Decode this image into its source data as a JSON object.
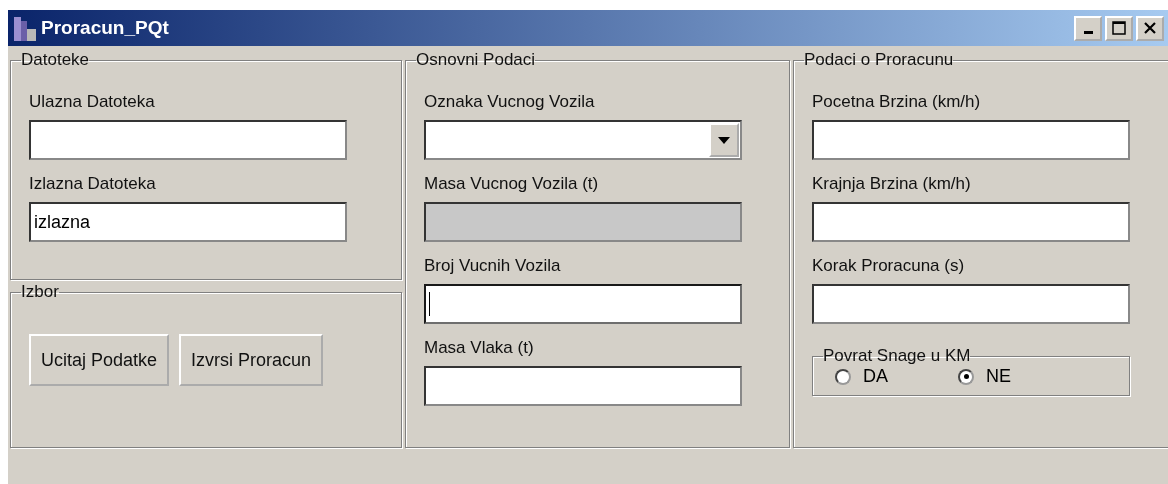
{
  "window": {
    "title": "Proracun_PQt"
  },
  "files": {
    "title": "Datoteke",
    "fields": [
      {
        "label": "Ulazna Datoteka",
        "kind": "text",
        "disabled": false,
        "focused": false
      },
      {
        "label": "Izlazna Datoteka",
        "kind": "text",
        "value": "izlazna",
        "disabled": false,
        "focused": false
      }
    ]
  },
  "choice": {
    "title": "Izbor",
    "buttons": [
      "Ucitaj Podatke",
      "Izvrsi Proracun"
    ]
  },
  "basic": {
    "title": "Osnovni Podaci",
    "fields": [
      {
        "label": "Oznaka Vucnog Vozila",
        "kind": "combo",
        "disabled": false,
        "focused": false
      },
      {
        "label": "Masa Vucnog Vozila (t)",
        "kind": "text",
        "disabled": true,
        "focused": false
      },
      {
        "label": "Broj Vucnih Vozila",
        "kind": "text",
        "disabled": false,
        "focused": true
      },
      {
        "label": "Masa Vlaka (t)",
        "kind": "text",
        "disabled": false,
        "focused": false
      }
    ]
  },
  "calc": {
    "title": "Podaci o Proracunu",
    "fields": [
      {
        "label": "Pocetna Brzina (km/h)",
        "kind": "text",
        "disabled": false,
        "focused": false
      },
      {
        "label": "Krajnja Brzina (km/h)",
        "kind": "text",
        "disabled": false,
        "focused": false
      },
      {
        "label": "Korak Proracuna (s)",
        "kind": "text",
        "disabled": false,
        "focused": false
      }
    ],
    "power_return": {
      "title": "Povrat Snage u KM",
      "options": [
        {
          "label": "DA",
          "selected": false
        },
        {
          "label": "NE",
          "selected": true
        }
      ]
    }
  }
}
